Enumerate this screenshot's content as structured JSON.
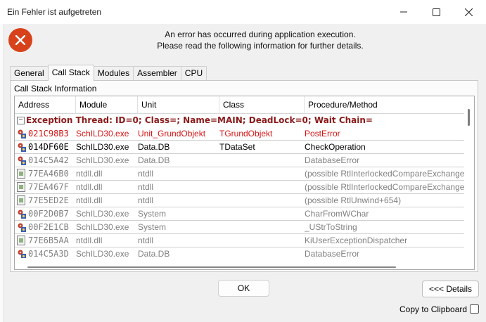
{
  "window": {
    "title": "Ein Fehler ist aufgetreten"
  },
  "message": {
    "line1": "An error has occurred during application execution.",
    "line2": "Please read the following information for further details."
  },
  "tabs": [
    {
      "label": "General"
    },
    {
      "label": "Call Stack"
    },
    {
      "label": "Modules"
    },
    {
      "label": "Assembler"
    },
    {
      "label": "CPU"
    }
  ],
  "active_tab": "Call Stack",
  "panel": {
    "label": "Call Stack Information"
  },
  "grid": {
    "columns": [
      "Address",
      "Module",
      "Unit",
      "Class",
      "Procedure/Method"
    ],
    "thread": "Exception Thread: ID=0; Class=; Name=MAIN; DeadLock=0; Wait Chain=",
    "rows": [
      {
        "icon": "gear-icon",
        "style": "red",
        "address": "021C98B3",
        "module": "SchILD30.exe",
        "unit": "Unit_GrundObjekt",
        "class": "TGrundObjekt",
        "proc": "PostError"
      },
      {
        "icon": "gear-icon",
        "style": "dark",
        "address": "014DF60E",
        "module": "SchILD30.exe",
        "unit": "Data.DB",
        "class": "TDataSet",
        "proc": "CheckOperation"
      },
      {
        "icon": "gear-icon",
        "style": "gray",
        "address": "014C5A42",
        "module": "SchILD30.exe",
        "unit": "Data.DB",
        "class": "",
        "proc": "DatabaseError"
      },
      {
        "icon": "dll-icon",
        "style": "gray",
        "address": "77EA46B0",
        "module": "ntdll.dll",
        "unit": "ntdll",
        "class": "",
        "proc": " (possible RtlInterlockedCompareExchange"
      },
      {
        "icon": "dll-icon",
        "style": "gray",
        "address": "77EA467F",
        "module": "ntdll.dll",
        "unit": "ntdll",
        "class": "",
        "proc": " (possible RtlInterlockedCompareExchange"
      },
      {
        "icon": "dll-icon",
        "style": "gray",
        "address": "77E5ED2E",
        "module": "ntdll.dll",
        "unit": "ntdll",
        "class": "",
        "proc": " (possible RtlUnwind+654)"
      },
      {
        "icon": "gear-icon",
        "style": "gray",
        "address": "00F2D0B7",
        "module": "SchILD30.exe",
        "unit": "System",
        "class": "",
        "proc": "CharFromWChar"
      },
      {
        "icon": "gear-icon",
        "style": "gray",
        "address": "00F2E1CB",
        "module": "SchILD30.exe",
        "unit": "System",
        "class": "",
        "proc": "_UStrToString"
      },
      {
        "icon": "dll-icon",
        "style": "gray",
        "address": "77E6B5AA",
        "module": "ntdll.dll",
        "unit": "ntdll",
        "class": "",
        "proc": "KiUserExceptionDispatcher"
      },
      {
        "icon": "gear-icon",
        "style": "gray",
        "address": "014C5A3D",
        "module": "SchILD30.exe",
        "unit": "Data.DB",
        "class": "",
        "proc": "DatabaseError"
      }
    ]
  },
  "buttons": {
    "ok": "OK",
    "details": "<<< Details"
  },
  "clipboard": {
    "label": "Copy to Clipboard",
    "checked": false
  },
  "colors": {
    "error_icon": "#d8421a",
    "thread_text": "#8b1a1a",
    "highlight_row": "#d61414"
  }
}
